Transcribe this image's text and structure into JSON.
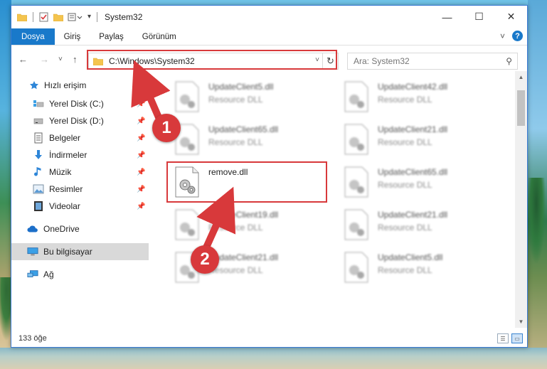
{
  "window": {
    "title": "System32",
    "controls": {
      "minimize": "—",
      "maximize": "☐",
      "close": "✕"
    }
  },
  "ribbon": {
    "tabs": [
      "Dosya",
      "Giriş",
      "Paylaş",
      "Görünüm"
    ],
    "active_tab": "Dosya",
    "expand_icon": "˅",
    "help_icon": "?"
  },
  "navigation": {
    "back": "←",
    "forward": "→",
    "recent": "˅",
    "up": "↑",
    "address": "C:\\Windows\\System32",
    "address_dropdown": "˅",
    "refresh": "↻",
    "search_placeholder": "Ara: System32",
    "search_icon": "⚲"
  },
  "sidebar": {
    "items": [
      {
        "label": "Hızlı erişim",
        "icon": "star-icon"
      },
      {
        "label": "Yerel Disk (C:)",
        "icon": "drive-icon",
        "pinned": true
      },
      {
        "label": "Yerel Disk (D:)",
        "icon": "drive-icon",
        "pinned": true
      },
      {
        "label": "Belgeler",
        "icon": "documents-icon",
        "pinned": true
      },
      {
        "label": "İndirmeler",
        "icon": "download-icon",
        "pinned": true
      },
      {
        "label": "Müzik",
        "icon": "music-icon",
        "pinned": true
      },
      {
        "label": "Resimler",
        "icon": "pictures-icon",
        "pinned": true
      },
      {
        "label": "Videolar",
        "icon": "video-icon",
        "pinned": true
      },
      {
        "label": "OneDrive",
        "icon": "cloud-icon"
      },
      {
        "label": "Bu bilgisayar",
        "icon": "computer-icon",
        "selected": true
      },
      {
        "label": "Ağ",
        "icon": "network-icon"
      }
    ],
    "pin_glyph": "📌"
  },
  "files": [
    {
      "name": "UpdateClient5.dll",
      "type": "Resource DLL",
      "blurred": true
    },
    {
      "name": "UpdateClient42.dll",
      "type": "Resource DLL",
      "blurred": true
    },
    {
      "name": "UpdateClient65.dll",
      "type": "Resource DLL",
      "blurred": true
    },
    {
      "name": "UpdateClient21.dll",
      "type": "Resource DLL",
      "blurred": true
    },
    {
      "name": "remove.dll",
      "type": "",
      "blurred": false,
      "highlighted": true
    },
    {
      "name": "UpdateClient65.dll",
      "type": "Resource DLL",
      "blurred": true
    },
    {
      "name": "UpdateClient19.dll",
      "type": "Resource DLL",
      "blurred": true
    },
    {
      "name": "UpdateClient21.dll",
      "type": "Resource DLL",
      "blurred": true
    },
    {
      "name": "UpdateClient21.dll",
      "type": "Resource DLL",
      "blurred": true
    },
    {
      "name": "UpdateClient5.dll",
      "type": "Resource DLL",
      "blurred": true
    }
  ],
  "status": {
    "item_count": "133 öğe"
  },
  "annotations": {
    "step1": "1",
    "step2": "2",
    "color": "#d8393b"
  },
  "colors": {
    "accent": "#1979ca",
    "highlight": "#d8393b",
    "selection": "#d9d9d9"
  }
}
